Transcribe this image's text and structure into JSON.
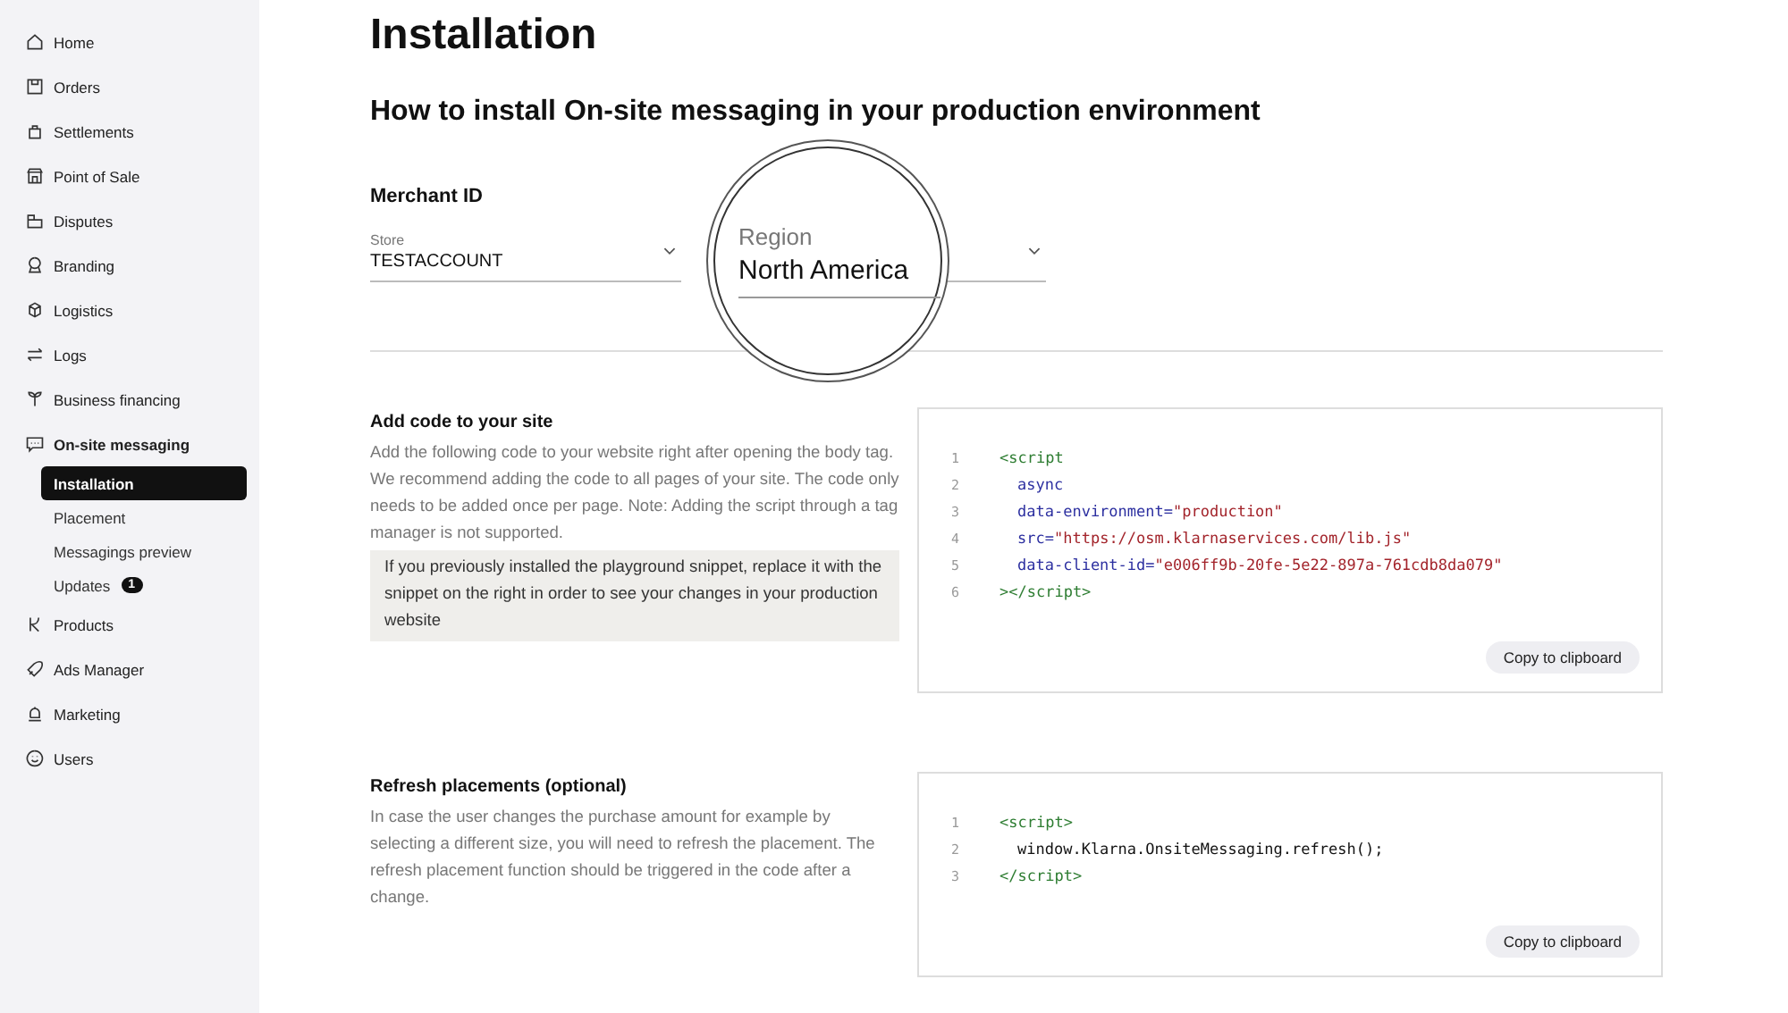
{
  "sidebar": {
    "items": [
      {
        "label": "Home",
        "selected": false
      },
      {
        "label": "Orders",
        "selected": false
      },
      {
        "label": "Settlements",
        "selected": false
      },
      {
        "label": "Point of Sale",
        "selected": false
      },
      {
        "label": "Disputes",
        "selected": false
      },
      {
        "label": "Branding",
        "selected": false
      },
      {
        "label": "Logistics",
        "selected": false
      },
      {
        "label": "Logs",
        "selected": false
      },
      {
        "label": "Business financing",
        "selected": false
      },
      {
        "label": "On-site messaging",
        "selected": false,
        "expanded": true,
        "children": [
          {
            "label": "Installation",
            "selected": true
          },
          {
            "label": "Placement",
            "selected": false
          },
          {
            "label": "Messagings preview",
            "selected": false
          },
          {
            "label": "Updates",
            "selected": false,
            "badge": "1"
          }
        ]
      },
      {
        "label": "Products",
        "selected": false
      },
      {
        "label": "Ads Manager",
        "selected": false
      },
      {
        "label": "Marketing",
        "selected": false
      },
      {
        "label": "Users",
        "selected": false
      }
    ]
  },
  "page": {
    "title": "Installation",
    "subtitle": "How to install On-site messaging in your production environment"
  },
  "merchant": {
    "heading": "Merchant ID",
    "store": {
      "label": "Store",
      "value": "TESTACCOUNT"
    },
    "region": {
      "label": "Region",
      "value": "North America"
    }
  },
  "sections": [
    {
      "heading": "Add code to your site",
      "text": "Add the following code to your website right after opening the body tag. We recommend adding the code to all pages of your site. The code only needs to be added once per page. Note: Adding the script through a tag manager is not supported.",
      "note": "If you previously installed the playground snippet, replace it with the snippet on the right in order to see your changes in your production website",
      "button": "Copy to clipboard",
      "code": [
        {
          "number": "1",
          "tokens": [
            {
              "kind": "tag",
              "text": "<script"
            }
          ],
          "children": [
            {
              "number": "2",
              "tokens": [
                {
                  "kind": "attr",
                  "text": "async"
                }
              ]
            },
            {
              "number": "3",
              "tokens": [
                {
                  "kind": "attr",
                  "text": "data-environment="
                },
                {
                  "kind": "string",
                  "text": "\"production\""
                }
              ]
            },
            {
              "number": "4",
              "tokens": [
                {
                  "kind": "attr",
                  "text": "src="
                },
                {
                  "kind": "string",
                  "text": "\"https://osm.klarnaservices.com/lib.js\""
                }
              ]
            },
            {
              "number": "5",
              "tokens": [
                {
                  "kind": "attr",
                  "text": "data-client-id="
                },
                {
                  "kind": "string",
                  "text": "\"e006ff9b-20fe-5e22-897a-761cdb8da079\""
                }
              ]
            }
          ]
        },
        {
          "number": "6",
          "tokens": [
            {
              "kind": "tag",
              "text": "></script>"
            }
          ]
        }
      ]
    },
    {
      "heading": "Refresh placements (optional)",
      "text": "In case the user changes the purchase amount for example by selecting a different size, you will need to refresh the placement. The refresh placement function should be triggered in the code after a change.",
      "button": "Copy to clipboard",
      "code": [
        {
          "number": "1",
          "tokens": [
            {
              "kind": "tag",
              "text": "<script>"
            }
          ],
          "children": [
            {
              "number": "2",
              "tokens": [
                {
                  "kind": "plain",
                  "text": "window.Klarna.OnsiteMessaging.refresh();"
                }
              ]
            }
          ]
        },
        {
          "number": "3",
          "tokens": [
            {
              "kind": "tag",
              "text": "</script>"
            }
          ]
        }
      ]
    }
  ]
}
